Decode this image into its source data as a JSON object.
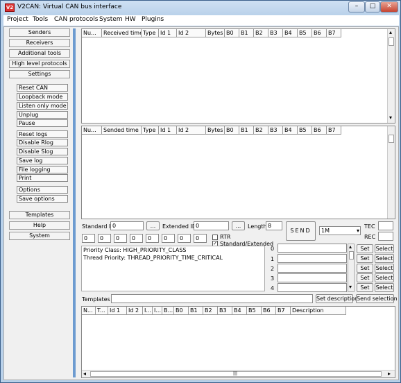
{
  "window": {
    "title": "V2CAN: Virtual CAN bus interface",
    "icon_text": "V2",
    "minimize": "–",
    "maximize": "□",
    "close": "✕"
  },
  "menu": [
    "Project",
    "Tools",
    "CAN protocols",
    "System",
    "HW",
    "Plugins"
  ],
  "sidebar": {
    "sections": [
      "Senders",
      "Receivers",
      "Additional tools",
      "High level protocols",
      "Settings"
    ],
    "settings_items": [
      "Reset CAN",
      "Loopback mode",
      "Listen only mode",
      "Unplug",
      "Pause",
      "Reset logs",
      "Disable Rlog",
      "Disable Slog",
      "Save log",
      "File logging",
      "Print",
      "Options",
      "Save options"
    ],
    "bottom_sections": [
      "Templates",
      "Help",
      "System"
    ]
  },
  "receive_grid": {
    "columns": [
      "Nu...",
      "Received time",
      "Type",
      "Id 1",
      "Id 2",
      "Bytes",
      "B0",
      "B1",
      "B2",
      "B3",
      "B4",
      "B5",
      "B6",
      "B7"
    ]
  },
  "send_grid": {
    "columns": [
      "Nu...",
      "Sended time",
      "Type",
      "Id 1",
      "Id 2",
      "Bytes",
      "B0",
      "B1",
      "B2",
      "B3",
      "B4",
      "B5",
      "B6",
      "B7"
    ]
  },
  "send_panel": {
    "standard_id_label": "Standard ID",
    "standard_id_value": "0",
    "ellipsis": "...",
    "extended_id_label": "Extended ID",
    "extended_id_value": "0",
    "length_label": "Length",
    "length_value": "8",
    "send_label": "SEND",
    "bitrate": "1M",
    "tec_label": "TEC",
    "rec_label": "REC",
    "bytes": [
      "0",
      "0",
      "0",
      "0",
      "0",
      "0",
      "0",
      "0"
    ],
    "rtr_label": "RTR",
    "std_ext_label": "Standard/Extended",
    "std_ext_checked": "✓"
  },
  "log_text": [
    "Priority Class: HIGH_PRIORITY_CLASS",
    "Thread Priority: THREAD_PRIORITY_TIME_CRITICAL"
  ],
  "quick_slots": {
    "numbers": [
      "0",
      "1",
      "2",
      "3",
      "4"
    ],
    "set_label": "Set",
    "select_label": "Select"
  },
  "templates": {
    "label": "Templates",
    "set_description": "Set description",
    "send_selection": "Send selection",
    "columns": [
      "N...",
      "T...",
      "Id 1",
      "Id 2",
      "I...",
      "I...",
      "B...",
      "B0",
      "B1",
      "B2",
      "B3",
      "B4",
      "B5",
      "B6",
      "B7",
      "Description"
    ]
  },
  "scroll": {
    "up": "▴",
    "down": "▾",
    "left": "◂",
    "right": "▸",
    "grip": "|||"
  }
}
